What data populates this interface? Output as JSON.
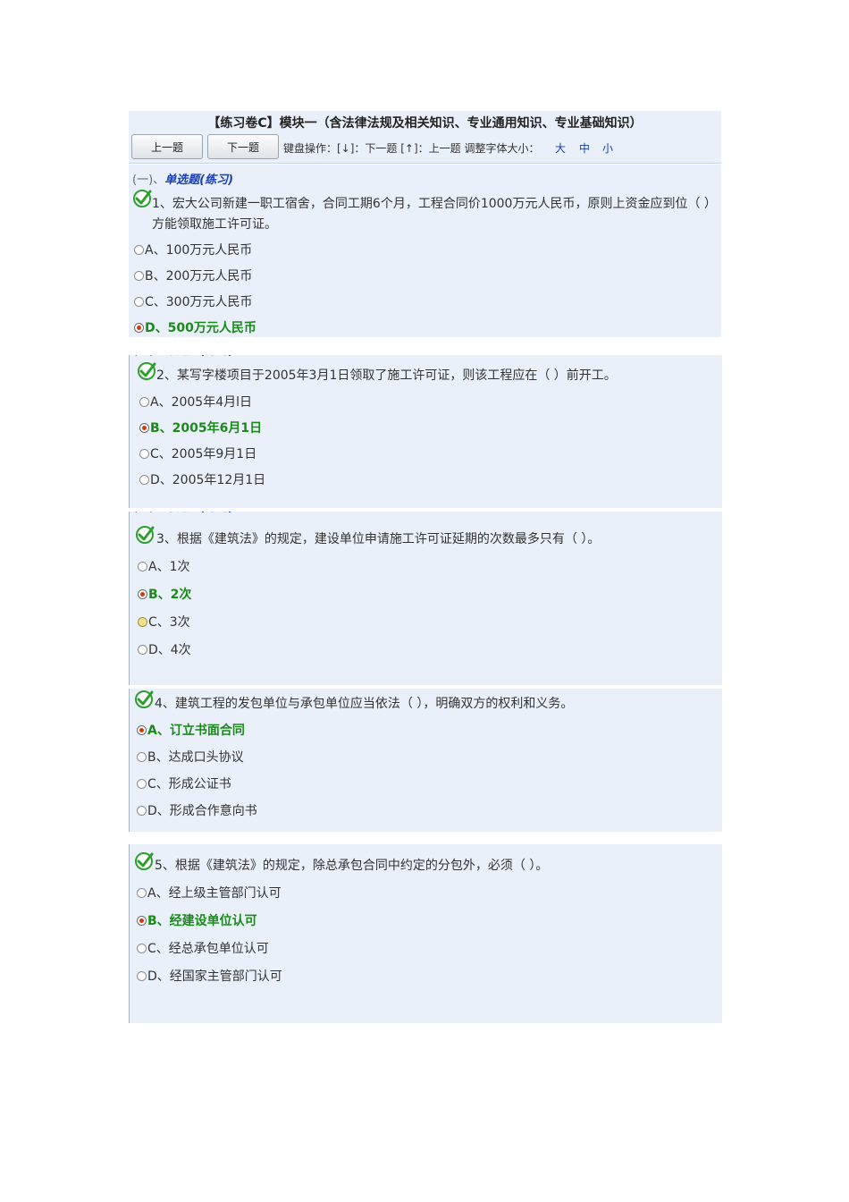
{
  "header": {
    "title": "【练习卷C】模块一（含法律法规及相关知识、专业通用知识、专业基础知识）",
    "prev_label": "上一题",
    "next_label": "下一题",
    "keyboard_hint": "键盘操作：[↓]：下一题 [↑]：上一题   调整字体大小：",
    "font_sizes": [
      "大",
      "中",
      "小"
    ]
  },
  "section": {
    "prefix": "(一)、",
    "title": "单选题(练习)"
  },
  "questions": [
    {
      "text": "1、宏大公司新建一职工宿舍，合同工期6个月，工程合同价1000万元人民币，原则上资金应到位（ ）方能领取施工许可证。",
      "options": [
        "A、100万元人民币",
        "B、200万元人民币",
        "C、300万元人民币",
        "D、500万元人民币"
      ],
      "correct": "D"
    },
    {
      "text": "2、某写字楼项目于2005年3月1日领取了施工许可证，则该工程应在（ ）前开工。",
      "options": [
        "A、2005年4月l日",
        "B、2005年6月1日",
        "C、2005年9月1日",
        "D、2005年12月1日"
      ],
      "correct": "B"
    },
    {
      "text": "3、根据《建筑法》的规定，建设单位申请施工许可证延期的次数最多只有（ ）。",
      "options": [
        "A、1次",
        "B、2次",
        "C、3次",
        "D、4次"
      ],
      "correct": "B"
    },
    {
      "text": "4、建筑工程的发包单位与承包单位应当依法（ ），明确双方的权利和义务。",
      "options": [
        "A、订立书面合同",
        "B、达成口头协议",
        "C、形成公证书",
        "D、形成合作意向书"
      ],
      "correct": "A"
    },
    {
      "text": "5、根据《建筑法》的规定，除总承包合同中约定的分包外，必须（ ）。",
      "options": [
        "A、经上级主管部门认可",
        "B、经建设单位认可",
        "C、经总承包单位认可",
        "D、经国家主管部门认可"
      ],
      "correct": "B"
    }
  ],
  "colors": {
    "panel_bg": "#e9f0fa",
    "correct_text": "#1a8a1a",
    "link_blue": "#1a3fb8",
    "check_green": "#2e9e2e"
  }
}
